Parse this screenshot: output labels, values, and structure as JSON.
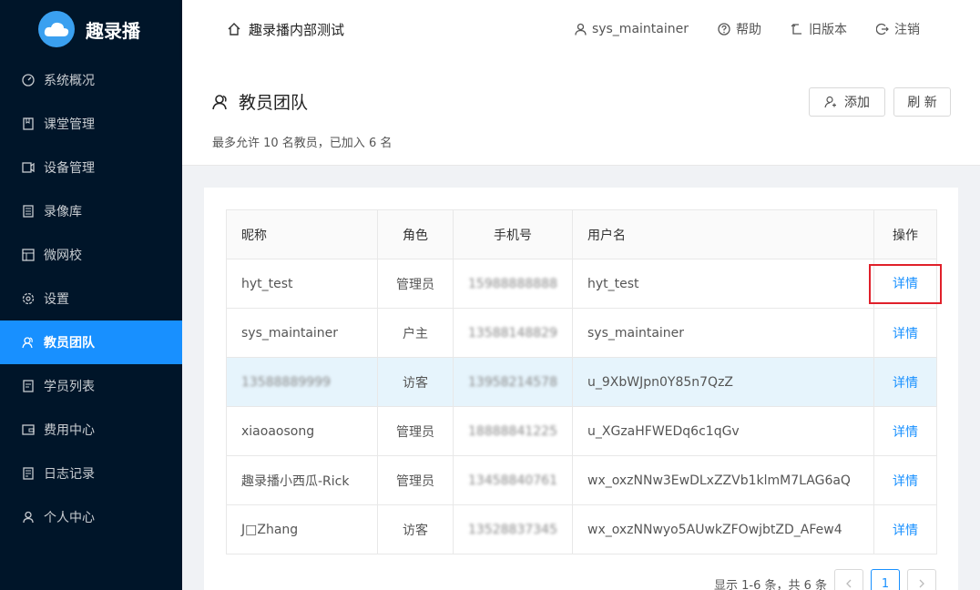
{
  "app": {
    "name": "趣录播"
  },
  "sidebar": {
    "items": [
      {
        "label": "系统概况",
        "icon": "dashboard-icon"
      },
      {
        "label": "课堂管理",
        "icon": "book-icon"
      },
      {
        "label": "设备管理",
        "icon": "device-icon"
      },
      {
        "label": "录像库",
        "icon": "video-library-icon"
      },
      {
        "label": "微网校",
        "icon": "school-icon"
      },
      {
        "label": "设置",
        "icon": "gear-icon"
      },
      {
        "label": "教员团队",
        "icon": "team-icon",
        "active": true
      },
      {
        "label": "学员列表",
        "icon": "list-icon"
      },
      {
        "label": "费用中心",
        "icon": "wallet-icon"
      },
      {
        "label": "日志记录",
        "icon": "log-icon"
      },
      {
        "label": "个人中心",
        "icon": "user-icon"
      }
    ]
  },
  "header": {
    "title": "趣录播内部测试",
    "user": "sys_maintainer",
    "help": "帮助",
    "old_version": "旧版本",
    "logout": "注销"
  },
  "page": {
    "title": "教员团队",
    "subtitle": "最多允许 10 名教员，已加入 6 名",
    "add_label": "添加",
    "refresh_label": "刷 新"
  },
  "table": {
    "columns": [
      "昵称",
      "角色",
      "手机号",
      "用户名",
      "操作"
    ],
    "rows": [
      {
        "nickname": "hyt_test",
        "role": "管理员",
        "phone": "15988888888",
        "username": "hyt_test",
        "action": "详情"
      },
      {
        "nickname": "sys_maintainer",
        "role": "户主",
        "phone": "13588148829",
        "username": "sys_maintainer",
        "action": "详情"
      },
      {
        "nickname": "13588889999",
        "role": "访客",
        "phone": "13958214578",
        "username": "u_9XbWJpn0Y85n7QzZ",
        "action": "详情"
      },
      {
        "nickname": "xiaoaosong",
        "role": "管理员",
        "phone": "18888841225",
        "username": "u_XGzaHFWEDq6c1qGv",
        "action": "详情"
      },
      {
        "nickname": "趣录播小西瓜-Rick",
        "role": "管理员",
        "phone": "13458840761",
        "username": "wx_oxzNNw3EwDLxZZVb1klmM7LAG6aQ",
        "action": "详情"
      },
      {
        "nickname": "J□Zhang",
        "role": "访客",
        "phone": "13528837345",
        "username": "wx_oxzNNwyo5AUwkZFOwjbtZD_AFew4",
        "action": "详情"
      }
    ]
  },
  "pagination": {
    "summary": "显示 1-6 条，共 6 条",
    "current": "1"
  },
  "colors": {
    "sidebar_bg": "#001529",
    "accent": "#1890ff",
    "highlight_row": "#e6f4fc",
    "annotation_border": "#e0202a"
  }
}
